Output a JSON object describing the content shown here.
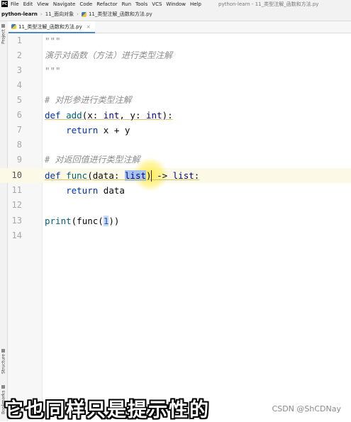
{
  "menubar": {
    "items": [
      "File",
      "Edit",
      "View",
      "Navigate",
      "Code",
      "Refactor",
      "Run",
      "Tools",
      "VCS",
      "Window",
      "Help"
    ],
    "window_title": "python-learn - 11_类型注解_函数和方法.py"
  },
  "navbar": {
    "project": "python-learn",
    "folder": "11_面向对象",
    "file": "11_类型注解_函数和方法.py"
  },
  "tab": {
    "label": "11_类型注解_函数和方法.py",
    "close": "×"
  },
  "side_panel": {
    "project": "Project",
    "structure": "Structure",
    "bookmarks": "Bookmarks"
  },
  "editor": {
    "line_numbers": [
      "1",
      "2",
      "3",
      "4",
      "5",
      "6",
      "7",
      "8",
      "9",
      "10",
      "11",
      "12",
      "13",
      "14"
    ],
    "current_line": "10",
    "lines": {
      "l1": "\"\"\"",
      "l2": "演示对函数（方法）进行类型注解",
      "l3": "\"\"\"",
      "l6": "# 对形参进行类型注解",
      "l7_kw": "def",
      "l7_fn": "add",
      "l7_rest1": "(x: ",
      "l7_t1": "int",
      "l7_rest2": ", y: ",
      "l7_t2": "int",
      "l7_rest3": "):",
      "l8_kw": "return",
      "l8_rest": " x + y",
      "l9": "# 对返回值进行类型注解",
      "l10_kw": "def",
      "l10_fn": "func",
      "l10_rest1": "(data: ",
      "l10_t1": "list",
      "l10_rest2": ") -> ",
      "l10_t2": "list",
      "l10_rest3": ":",
      "l11_kw": "return",
      "l11_rest": " data",
      "l13_fn": "print",
      "l13_a": "(",
      "l13_fn2": "func",
      "l13_b": "(",
      "l13_num": "1",
      "l13_c": "))"
    }
  },
  "subtitle": "它也同样只是提示性的",
  "watermark": "CSDN @ShCDNay",
  "colors": {
    "keyword": "#0033b3",
    "comment": "#8c8c8c",
    "selection": "#a6c3f0",
    "current_line": "#fcfae6"
  }
}
